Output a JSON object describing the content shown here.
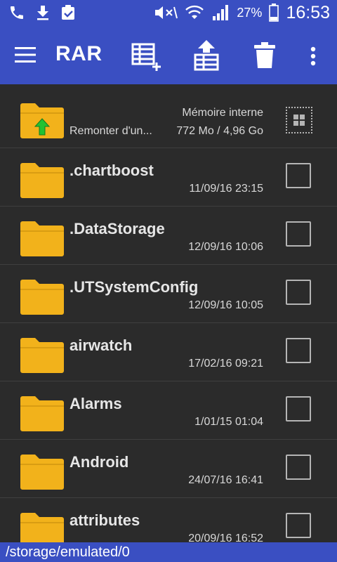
{
  "status": {
    "battery": "27%",
    "time": "16:53"
  },
  "appbar": {
    "title": "RAR"
  },
  "parent_row": {
    "storage_label": "Mémoire interne",
    "up_label": "Remonter d'un...",
    "space": "772 Mo / 4,96 Go"
  },
  "files": [
    {
      "name": ".chartboost",
      "date": "11/09/16 23:15"
    },
    {
      "name": ".DataStorage",
      "date": "12/09/16 10:06"
    },
    {
      "name": ".UTSystemConfig",
      "date": "12/09/16 10:05"
    },
    {
      "name": "airwatch",
      "date": "17/02/16 09:21"
    },
    {
      "name": "Alarms",
      "date": "1/01/15 01:04"
    },
    {
      "name": "Android",
      "date": "24/07/16 16:41"
    },
    {
      "name": "attributes",
      "date": "20/09/16 16:52"
    }
  ],
  "path": "/storage/emulated/0",
  "colors": {
    "accent": "#3a4fc2",
    "background": "#2b2b2b",
    "folder": "#f2b21b",
    "up_arrow": "#22c232"
  }
}
